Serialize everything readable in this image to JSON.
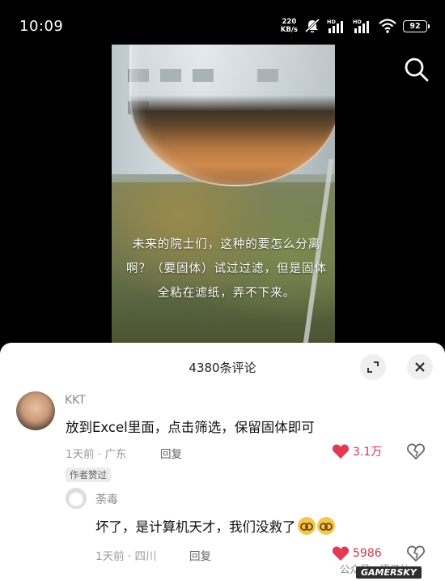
{
  "status_bar": {
    "time": "10:09",
    "net_speed_value": "220",
    "net_speed_unit": "KB/s",
    "sim1_label": "HD",
    "sim2_label": "HD",
    "battery": "92"
  },
  "video": {
    "caption": "未来的院士们，这种的要怎么分离啊？（要固体）试过过滤，但是固体全粘在滤纸，弄不下来。"
  },
  "comments_panel": {
    "title": "4380条评论",
    "comments": [
      {
        "username": "KKT",
        "text": "放到Excel里面，点击筛选，保留固体即可",
        "time": "1天前",
        "location": "广东",
        "reply_label": "回复",
        "likes": "3.1万"
      }
    ],
    "author_badge": "作者赞过",
    "replies": [
      {
        "username": "荼毒",
        "text": "坏了，是计算机天才，我们没救了",
        "time": "1天前",
        "location": "四川",
        "reply_label": "回复",
        "likes": "5986"
      }
    ]
  },
  "watermark": {
    "text": "公众号 · 语录体",
    "logo": "GAMERSKY"
  },
  "colors": {
    "like_red": "#d6334a",
    "sheet_bg": "#ffffff",
    "status_bg": "#000000"
  },
  "icons": [
    "search-icon",
    "expand-icon",
    "close-icon",
    "heart-icon",
    "broken-heart-icon",
    "wifi-icon",
    "mute-icon",
    "battery-icon"
  ]
}
